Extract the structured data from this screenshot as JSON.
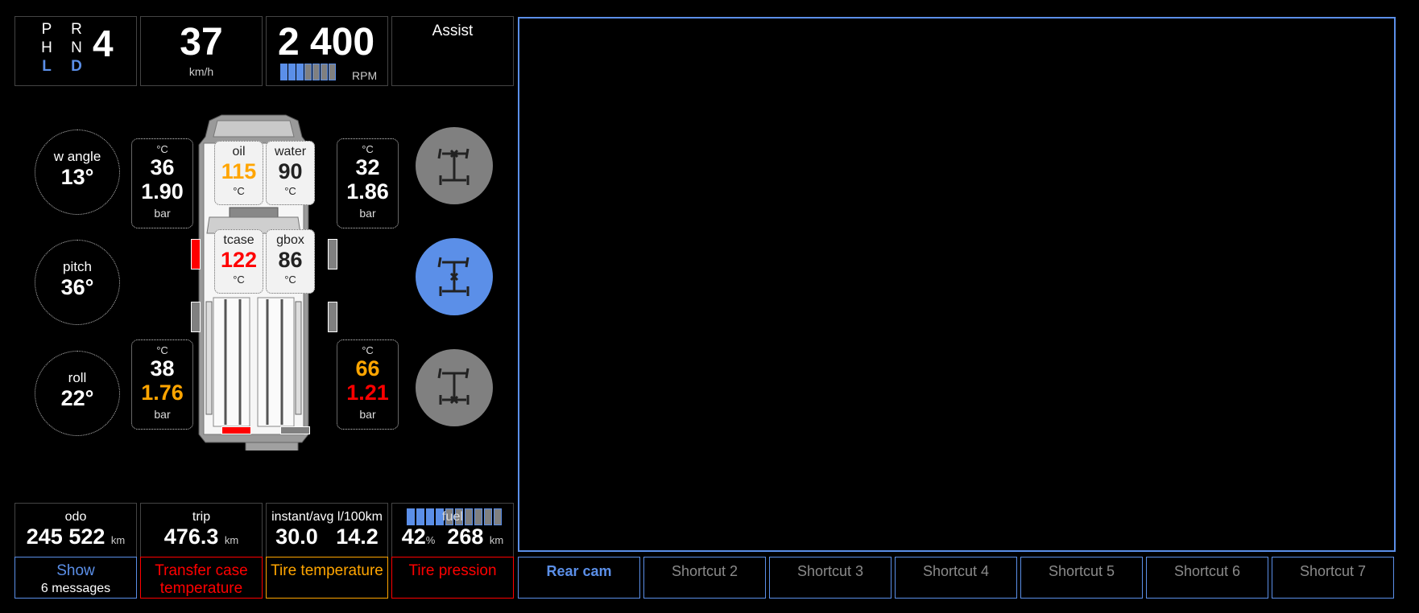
{
  "colors": {
    "accent": "#5b8fe8",
    "warning": "#ffa500",
    "critical": "#ff0000",
    "neutral": "#808080",
    "border": "#444444"
  },
  "gear": {
    "positions": [
      {
        "label": "P",
        "active": false
      },
      {
        "label": "R",
        "active": false
      },
      {
        "label": "H",
        "active": false
      },
      {
        "label": "N",
        "active": false
      },
      {
        "label": "L",
        "active": true
      },
      {
        "label": "D",
        "active": true
      }
    ],
    "current": "4"
  },
  "speed": {
    "value": "37",
    "unit": "km/h"
  },
  "rpm": {
    "value": "2 400",
    "unit": "RPM",
    "segments_total": 7,
    "segments_on": 3
  },
  "assist": {
    "title": "Assist"
  },
  "attitude": {
    "wheel_angle": {
      "label": "w angle",
      "value": "13°"
    },
    "pitch": {
      "label": "pitch",
      "value": "36°"
    },
    "roll": {
      "label": "roll",
      "value": "22°"
    }
  },
  "tires": {
    "front_left": {
      "temp_unit": "°C",
      "temp": "36",
      "temp_status": "normal",
      "pressure": "1.90",
      "pressure_status": "normal",
      "pressure_unit": "bar"
    },
    "front_right": {
      "temp_unit": "°C",
      "temp": "32",
      "temp_status": "normal",
      "pressure": "1.86",
      "pressure_status": "normal",
      "pressure_unit": "bar"
    },
    "rear_left": {
      "temp_unit": "°C",
      "temp": "38",
      "temp_status": "normal",
      "pressure": "1.76",
      "pressure_status": "warning",
      "pressure_unit": "bar"
    },
    "rear_right": {
      "temp_unit": "°C",
      "temp": "66",
      "temp_status": "warning",
      "pressure": "1.21",
      "pressure_status": "critical",
      "pressure_unit": "bar"
    }
  },
  "fluids": {
    "oil": {
      "label": "oil",
      "value": "115",
      "unit": "°C",
      "status": "warning"
    },
    "water": {
      "label": "water",
      "value": "90",
      "unit": "°C",
      "status": "normal"
    },
    "tcase": {
      "label": "tcase",
      "value": "122",
      "unit": "°C",
      "status": "critical"
    },
    "gbox": {
      "label": "gbox",
      "value": "86",
      "unit": "°C",
      "status": "normal"
    }
  },
  "doors": {
    "front_left": "open",
    "front_right": "closed",
    "rear_left": "closed",
    "rear_right": "closed",
    "tailgate_left": "open",
    "tailgate_right": "closed"
  },
  "drive_modes": [
    {
      "name": "front-axle-lock",
      "active": false
    },
    {
      "name": "center-diff-lock",
      "active": true
    },
    {
      "name": "rear-axle-lock",
      "active": false
    }
  ],
  "stats": {
    "odo": {
      "label": "odo",
      "value": "245 522",
      "unit": "km"
    },
    "trip": {
      "label": "trip",
      "value": "476.3",
      "unit": "km"
    },
    "consumption": {
      "label": "instant/avg l/100km",
      "instant": "30.0",
      "average": "14.2"
    },
    "fuel": {
      "label": "fuel",
      "percent": "42",
      "percent_unit": "%",
      "range": "268",
      "range_unit": "km",
      "segments_total": 10,
      "segments_on": 4
    }
  },
  "alerts": {
    "messages": {
      "line1": "Show",
      "line2": "6 messages"
    },
    "transfer_case": {
      "text": "Transfer case temperature"
    },
    "tire_temp": {
      "text": "Tire temperature"
    },
    "tire_pression": {
      "text": "Tire pression"
    }
  },
  "shortcuts": [
    {
      "label": "Rear cam",
      "active": true
    },
    {
      "label": "Shortcut 2",
      "active": false
    },
    {
      "label": "Shortcut 3",
      "active": false
    },
    {
      "label": "Shortcut 4",
      "active": false
    },
    {
      "label": "Shortcut 5",
      "active": false
    },
    {
      "label": "Shortcut 6",
      "active": false
    },
    {
      "label": "Shortcut 7",
      "active": false
    }
  ]
}
